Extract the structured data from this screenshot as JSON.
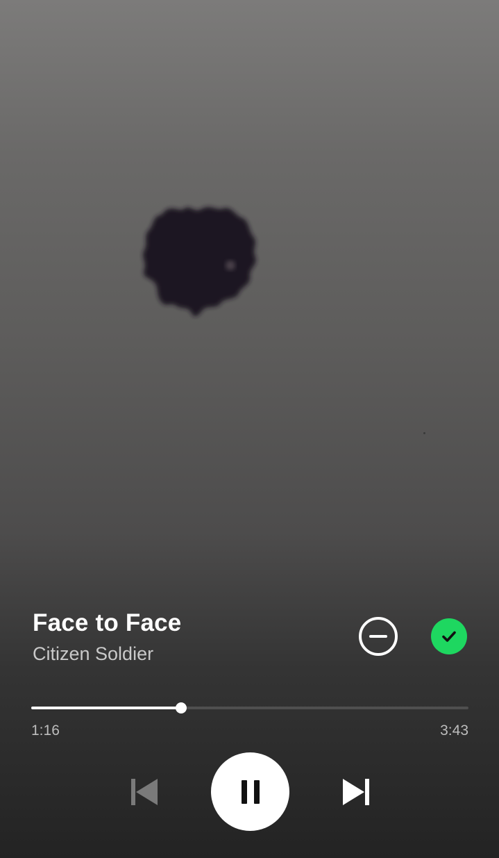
{
  "track": {
    "title": "Face to Face",
    "artist": "Citizen Soldier"
  },
  "playback": {
    "elapsed": "1:16",
    "duration": "3:43",
    "progress_fraction": 0.343,
    "state": "playing"
  },
  "icons": {
    "hide": "minus-circle-icon",
    "liked": "check-icon",
    "previous": "skip-back-icon",
    "pause": "pause-icon",
    "next": "skip-forward-icon"
  },
  "colors": {
    "accent": "#1ed760",
    "primary_text": "#ffffff",
    "secondary_text": "#c9c9c9",
    "previous_disabled": "#7a7a7a"
  }
}
